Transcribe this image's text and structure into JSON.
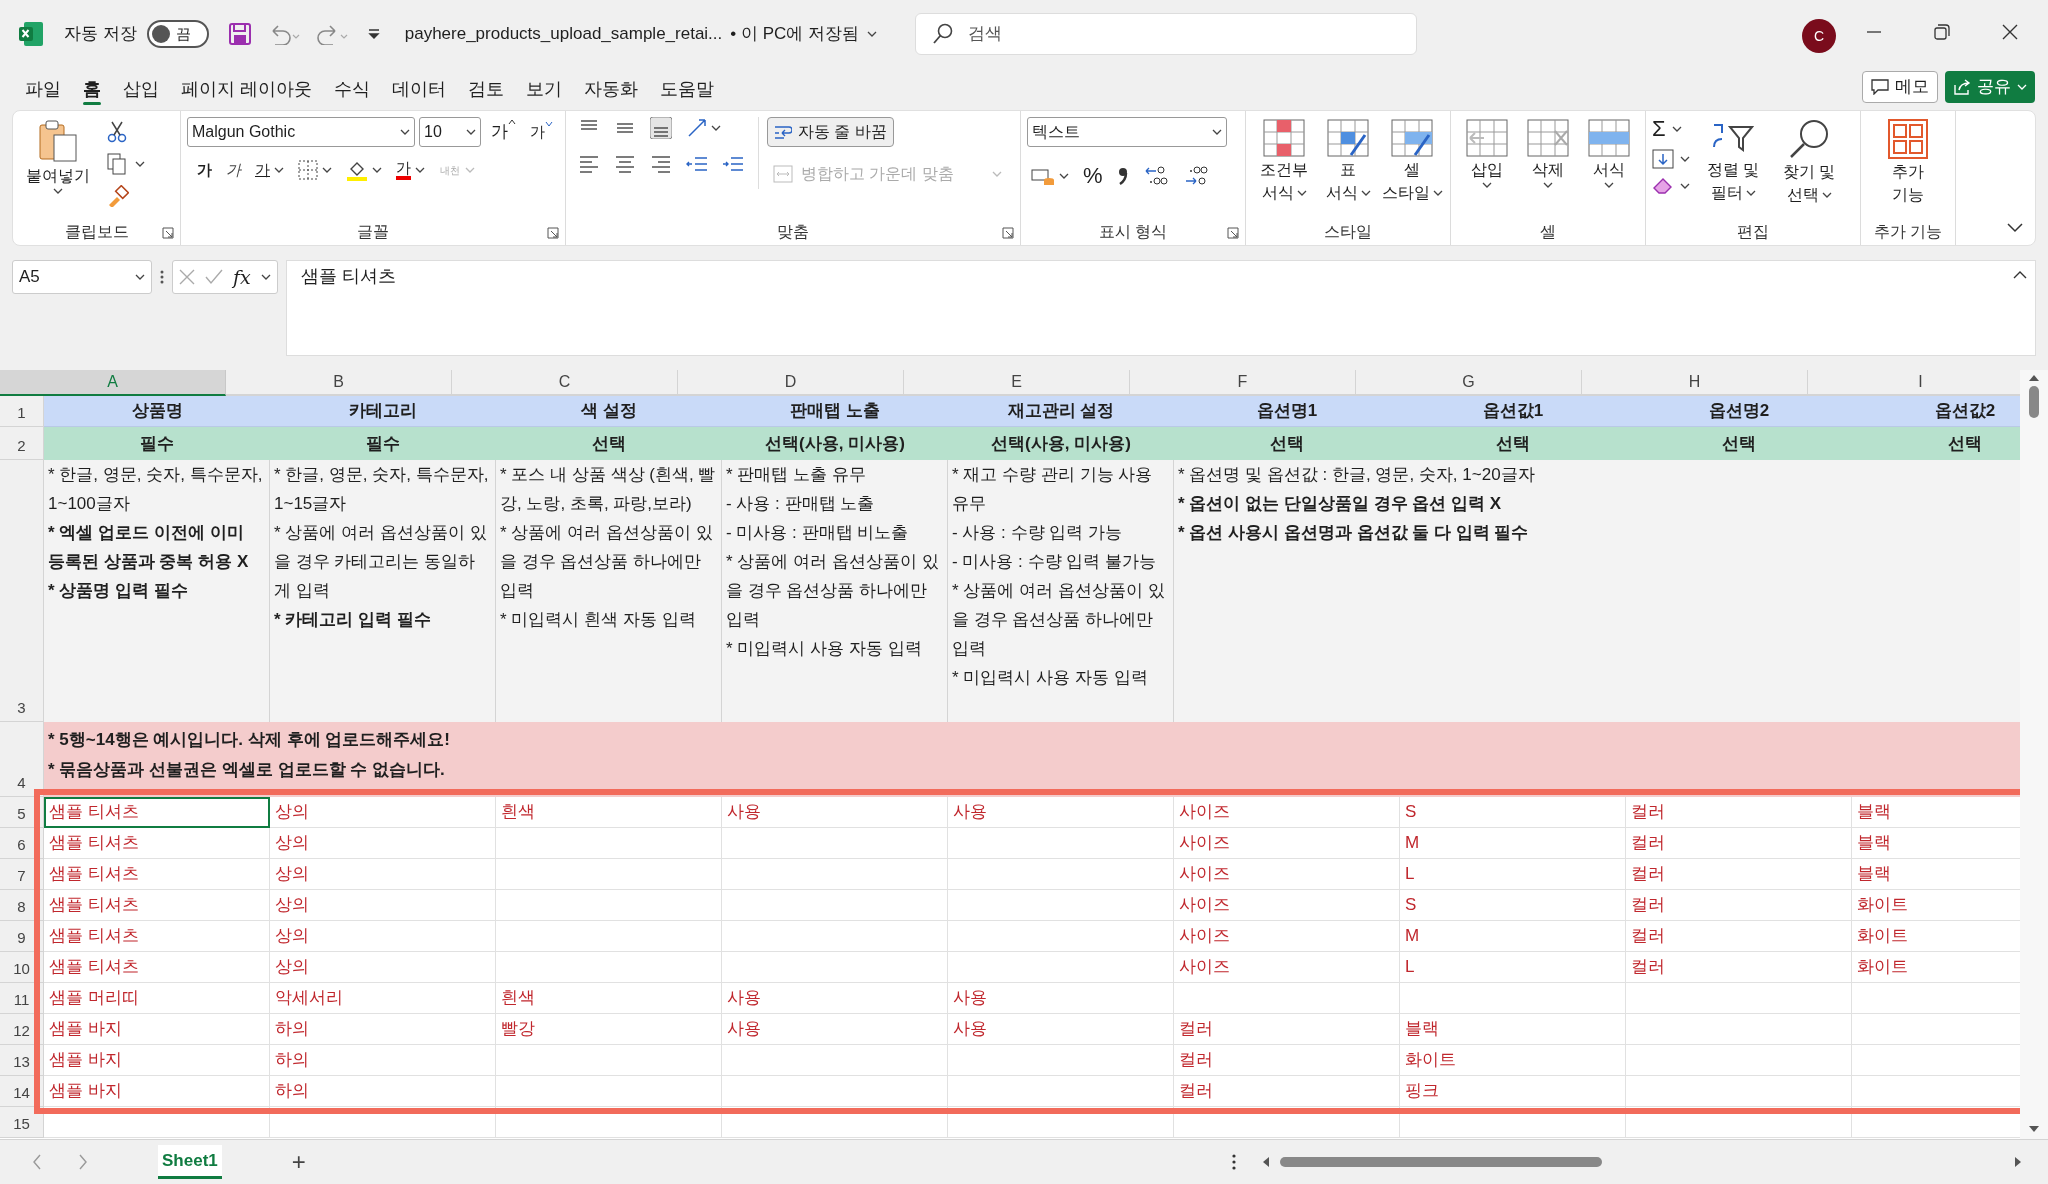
{
  "title_bar": {
    "autosave_label": "자동 저장",
    "autosave_on": false,
    "autosave_state": "끔",
    "filename": "payhere_products_upload_sample_retai...",
    "save_status": "• 이 PC에 저장됨",
    "search_placeholder": "검색",
    "user_initial": "C"
  },
  "menu_tabs": [
    {
      "label": "파일",
      "selected": false
    },
    {
      "label": "홈",
      "selected": true
    },
    {
      "label": "삽입",
      "selected": false
    },
    {
      "label": "페이지 레이아웃",
      "selected": false
    },
    {
      "label": "수식",
      "selected": false
    },
    {
      "label": "데이터",
      "selected": false
    },
    {
      "label": "검토",
      "selected": false
    },
    {
      "label": "보기",
      "selected": false
    },
    {
      "label": "자동화",
      "selected": false
    },
    {
      "label": "도움말",
      "selected": false
    }
  ],
  "top_buttons": {
    "memo": "메모",
    "share": "공유"
  },
  "ribbon": [
    {
      "kind": "clipboard",
      "label": "클립보드",
      "paste": "붙여넣기"
    },
    {
      "kind": "font",
      "label": "글꼴",
      "font_name": "Malgun Gothic",
      "font_size": "10",
      "grow": "가",
      "shrink": "가",
      "bold": "가",
      "italic": "가",
      "underline": "가",
      "font_color": "가",
      "phonetic": "내천"
    },
    {
      "kind": "alignment",
      "label": "맞춤",
      "wrap": "자동 줄 바꿈",
      "merge": "병합하고 가운데 맞춤"
    },
    {
      "kind": "number",
      "label": "표시 형식",
      "format": "텍스트",
      "percent": "%"
    },
    {
      "kind": "styles",
      "label": "스타일",
      "buttons": [
        {
          "lines": [
            "조건부",
            "서식"
          ]
        },
        {
          "lines": [
            "표",
            "서식"
          ]
        },
        {
          "lines": [
            "셀",
            "스타일"
          ]
        }
      ]
    },
    {
      "kind": "cells",
      "label": "셀",
      "buttons": [
        {
          "lines": [
            "삽입"
          ]
        },
        {
          "lines": [
            "삭제"
          ]
        },
        {
          "lines": [
            "서식"
          ]
        }
      ]
    },
    {
      "kind": "editing",
      "label": "편집",
      "sum": "Σ",
      "buttons": [
        {
          "lines": [
            "정렬 및",
            "필터"
          ]
        },
        {
          "lines": [
            "찾기 및",
            "선택"
          ]
        }
      ]
    },
    {
      "kind": "addins",
      "label": "추가 기능",
      "buttons": [
        {
          "lines": [
            "추가",
            "기능"
          ]
        }
      ]
    }
  ],
  "formula_bar": {
    "name_box": "A5",
    "fx": "fx",
    "formula": "샘플 티셔츠"
  },
  "sheet": {
    "columns": [
      {
        "label": "A",
        "selected": true
      },
      {
        "label": "B",
        "selected": false
      },
      {
        "label": "C",
        "selected": false
      },
      {
        "label": "D",
        "selected": false
      },
      {
        "label": "E",
        "selected": false
      },
      {
        "label": "F",
        "selected": false
      },
      {
        "label": "G",
        "selected": false
      },
      {
        "label": "H",
        "selected": false
      },
      {
        "label": "I",
        "selected": false
      }
    ],
    "header_row": {
      "row": "1",
      "cells": [
        "상품명",
        "카테고리",
        "색 설정",
        "판매탭 노출",
        "재고관리 설정",
        "옵션명1",
        "옵션값1",
        "옵션명2",
        "옵션값2"
      ]
    },
    "requirement_row": {
      "row": "2",
      "cells": [
        "필수",
        "필수",
        "선택",
        "선택(사용, 미사용)",
        "선택(사용, 미사용)",
        "선택",
        "선택",
        "선택",
        "선택"
      ]
    },
    "guide_row": {
      "row": "3",
      "cells": [
        [
          {
            "text": "* 한글, 영문, 숫자, 특수문자, 1~100글자",
            "bold": false
          },
          {
            "text": "* 엑셀 업로드 이전에 이미 등록된 상품과 중복 허용 X",
            "bold": true
          },
          {
            "text": "* 상품명 입력 필수",
            "bold": true
          }
        ],
        [
          {
            "text": "* 한글, 영문, 숫자, 특수문자, 1~15글자",
            "bold": false
          },
          {
            "text": "* 상품에 여러 옵션상품이 있을 경우 카테고리는 동일하게 입력",
            "bold": false
          },
          {
            "text": "* 카테고리 입력 필수",
            "bold": true
          }
        ],
        [
          {
            "text": "* 포스 내 상품 색상 (흰색, 빨강, 노랑, 초록, 파랑,보라)",
            "bold": false
          },
          {
            "text": "* 상품에 여러 옵션상품이 있을 경우 옵션상품 하나에만 입력",
            "bold": false
          },
          {
            "text": "* 미입력시 흰색 자동 입력",
            "bold": false
          }
        ],
        [
          {
            "text": "* 판매탭 노출 유무",
            "bold": false
          },
          {
            "text": "- 사용 : 판매탭 노출",
            "bold": false
          },
          {
            "text": "- 미사용 : 판매탭 비노출",
            "bold": false
          },
          {
            "text": "* 상품에 여러 옵션상품이 있을 경우 옵션상품 하나에만 입력",
            "bold": false
          },
          {
            "text": "* 미입력시 사용 자동 입력",
            "bold": false
          }
        ],
        [
          {
            "text": "* 재고 수량 관리 기능 사용 유무",
            "bold": false
          },
          {
            "text": "- 사용 : 수량 입력 가능",
            "bold": false
          },
          {
            "text": "- 미사용 : 수량 입력 불가능",
            "bold": false
          },
          {
            "text": "* 상품에 여러 옵션상품이 있을 경우 옵션상품 하나에만 입력",
            "bold": false
          },
          {
            "text": "* 미입력시 사용 자동 입력",
            "bold": false
          }
        ],
        [
          {
            "text": "* 옵션명 및 옵션값 : 한글, 영문, 숫자, 1~20글자",
            "bold": false
          },
          {
            "text": "* 옵션이 없는 단일상품일 경우 옵션 입력 X",
            "bold": true
          },
          {
            "text": "* 옵션 사용시 옵션명과 옵션값 둘 다 입력 필수",
            "bold": true
          }
        ]
      ]
    },
    "note_row": {
      "row": "4",
      "lines": [
        "* 5행~14행은 예시입니다. 삭제 후에 업로드해주세요!",
        "* 묶음상품과 선불권은 엑셀로 업로드할 수 없습니다."
      ]
    },
    "data_rows": [
      {
        "row": "5",
        "selected": true,
        "cells": {
          "A": "샘플 티셔츠",
          "B": "상의",
          "C": "흰색",
          "D": "사용",
          "E": "사용",
          "F": "사이즈",
          "G": "S",
          "H": "컬러",
          "I": "블랙"
        }
      },
      {
        "row": "6",
        "selected": false,
        "cells": {
          "A": "샘플 티셔츠",
          "B": "상의",
          "F": "사이즈",
          "G": "M",
          "H": "컬러",
          "I": "블랙"
        }
      },
      {
        "row": "7",
        "selected": false,
        "cells": {
          "A": "샘플 티셔츠",
          "B": "상의",
          "F": "사이즈",
          "G": "L",
          "H": "컬러",
          "I": "블랙"
        }
      },
      {
        "row": "8",
        "selected": false,
        "cells": {
          "A": "샘플 티셔츠",
          "B": "상의",
          "F": "사이즈",
          "G": "S",
          "H": "컬러",
          "I": "화이트"
        }
      },
      {
        "row": "9",
        "selected": false,
        "cells": {
          "A": "샘플 티셔츠",
          "B": "상의",
          "F": "사이즈",
          "G": "M",
          "H": "컬러",
          "I": "화이트"
        }
      },
      {
        "row": "10",
        "selected": false,
        "cells": {
          "A": "샘플 티셔츠",
          "B": "상의",
          "F": "사이즈",
          "G": "L",
          "H": "컬러",
          "I": "화이트"
        }
      },
      {
        "row": "11",
        "selected": false,
        "cells": {
          "A": "샘플 머리띠",
          "B": "악세서리",
          "C": "흰색",
          "D": "사용",
          "E": "사용"
        }
      },
      {
        "row": "12",
        "selected": false,
        "cells": {
          "A": "샘플 바지",
          "B": "하의",
          "C": "빨강",
          "D": "사용",
          "E": "사용",
          "F": "컬러",
          "G": "블랙"
        }
      },
      {
        "row": "13",
        "selected": false,
        "cells": {
          "A": "샘플 바지",
          "B": "하의",
          "F": "컬러",
          "G": "화이트"
        }
      },
      {
        "row": "14",
        "selected": false,
        "cells": {
          "A": "샘플 바지",
          "B": "하의",
          "F": "컬러",
          "G": "핑크"
        }
      }
    ],
    "empty_row": "15"
  },
  "sheet_tabs": [
    {
      "label": "Sheet1",
      "selected": true
    }
  ],
  "add_sheet": "+"
}
